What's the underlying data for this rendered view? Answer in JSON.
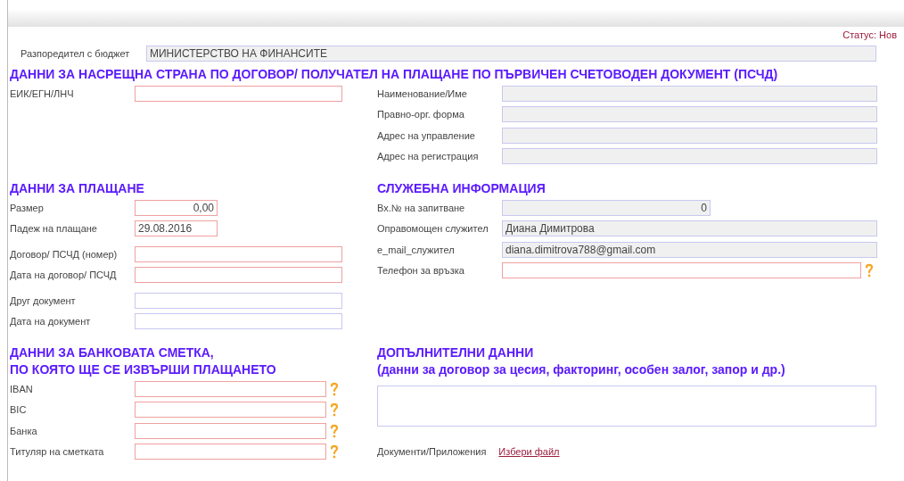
{
  "status": {
    "label": "Статус:",
    "value": "Нов"
  },
  "budget": {
    "label": "Разпоредител с бюджет",
    "value": "МИНИСТЕРСТВО НА ФИНАНСИТЕ"
  },
  "counterparty": {
    "title": "ДАННИ ЗА НАСРЕЩНА СТРАНА ПО ДОГОВОР/ ПОЛУЧАТЕЛ НА ПЛАЩАНЕ ПО ПЪРВИЧЕН СЧЕТОВОДЕН ДОКУМЕНТ (ПСЧД)",
    "left": [
      {
        "label": "ЕИК/ЕГН/ЛНЧ",
        "kind": "required"
      }
    ],
    "right": [
      {
        "label": "Наименование/Име",
        "kind": "readonly"
      },
      {
        "label": "Правно-орг. форма",
        "kind": "readonly"
      },
      {
        "label": "Адрес на управление",
        "kind": "readonly"
      },
      {
        "label": "Адрес на регистрация",
        "kind": "readonly"
      }
    ]
  },
  "payment": {
    "title": "ДАННИ ЗА ПЛАЩАНЕ",
    "fields": [
      {
        "label": "Размер",
        "kind": "required",
        "value": "0,00"
      },
      {
        "label": "Падеж на плащане",
        "kind": "required",
        "value": "29.08.2016"
      },
      {
        "label": "Договор/ ПСЧД (номер)",
        "kind": "required"
      },
      {
        "label": "Дата на договор/ ПСЧД",
        "kind": "required"
      },
      {
        "label": "Друг документ",
        "kind": "optional"
      },
      {
        "label": "Дата на документ",
        "kind": "optional"
      }
    ]
  },
  "service": {
    "title": "СЛУЖЕБНА ИНФОРМАЦИЯ",
    "fields": [
      {
        "label": "Вх.№ на запитване",
        "kind": "readonly",
        "value": "0"
      },
      {
        "label": "Оправомощен служител",
        "kind": "readonly",
        "value": "Диана Димитрова"
      },
      {
        "label": "e_mail_служител",
        "kind": "readonly",
        "value": "diana.dimitrova788@gmail.com"
      },
      {
        "label": "Телефон за връзка",
        "kind": "required",
        "help": true
      }
    ]
  },
  "bank": {
    "title_lines": [
      "ДАННИ ЗА БАНКОВАТА СМЕТКА,",
      "ПО КОЯТО ЩЕ СЕ ИЗВЪРШИ ПЛАЩАНЕТО"
    ],
    "fields": [
      {
        "label": "IBAN",
        "kind": "required",
        "help": true
      },
      {
        "label": "BIC",
        "kind": "required",
        "help": true
      },
      {
        "label": "Банка",
        "kind": "required",
        "help": true
      },
      {
        "label": "Титуляр на сметката",
        "kind": "required",
        "help": true
      }
    ]
  },
  "additional": {
    "title": "ДОПЪЛНИТЕЛНИ ДАННИ",
    "subtitle": "(данни за договор за цесия, факторинг,  особен залог, запор и др.)",
    "documents_label": "Документи/Приложения",
    "file_link": "Избери файл"
  }
}
